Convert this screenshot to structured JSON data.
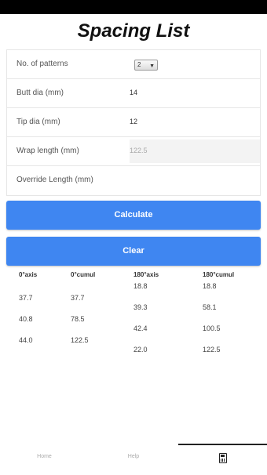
{
  "title": "Spacing List",
  "form": {
    "patterns_label": "No. of patterns",
    "patterns_value": "2",
    "butt_label": "Butt dia (mm)",
    "butt_value": "14",
    "tip_label": "Tip dia (mm)",
    "tip_value": "12",
    "wrap_label": "Wrap length (mm)",
    "wrap_value": "122.5",
    "override_label": "Override Length (mm)",
    "override_value": ""
  },
  "buttons": {
    "calculate": "Calculate",
    "clear": "Clear"
  },
  "results": {
    "headers": [
      "0°axis",
      "0°cumul",
      "180°axis",
      "180°cumul"
    ],
    "col0": [
      "37.7",
      "40.8",
      "44.0"
    ],
    "col1": [
      "37.7",
      "78.5",
      "122.5"
    ],
    "col2": [
      "18.8",
      "39.3",
      "42.4",
      "22.0"
    ],
    "col3": [
      "18.8",
      "58.1",
      "100.5",
      "122.5"
    ]
  },
  "nav": {
    "home": "Home",
    "help": "Help",
    "calc_icon": "calculator-icon"
  },
  "colors": {
    "button_blue": "#3f86f1"
  }
}
